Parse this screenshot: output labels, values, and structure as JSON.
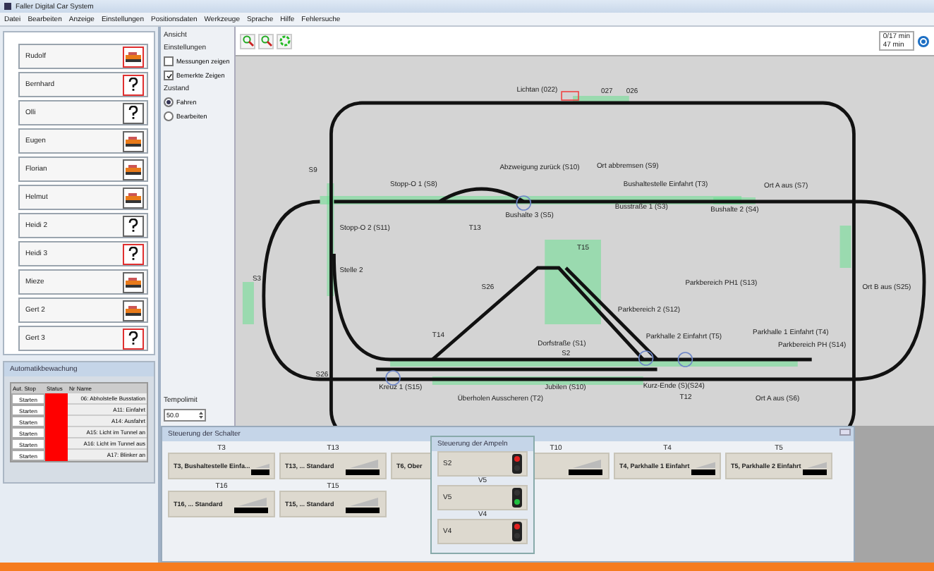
{
  "window": {
    "title": "Faller Digital Car System"
  },
  "menu": [
    "Datei",
    "Bearbeiten",
    "Anzeige",
    "Einstellungen",
    "Positionsdaten",
    "Werkzeuge",
    "Sprache",
    "Hilfe",
    "Fehlersuche"
  ],
  "vehicles": [
    {
      "name": "Rudolf",
      "kind": "car",
      "flagged": true
    },
    {
      "name": "Bernhard",
      "kind": "unknown",
      "flagged": true
    },
    {
      "name": "Olli",
      "kind": "unknown",
      "flagged": false
    },
    {
      "name": "Eugen",
      "kind": "car",
      "flagged": false
    },
    {
      "name": "Florian",
      "kind": "car",
      "flagged": false
    },
    {
      "name": "Helmut",
      "kind": "car",
      "flagged": false
    },
    {
      "name": "Heidi 2",
      "kind": "unknown",
      "flagged": false
    },
    {
      "name": "Heidi 3",
      "kind": "unknown",
      "flagged": true
    },
    {
      "name": "Mieze",
      "kind": "car",
      "flagged": false
    },
    {
      "name": "Gert 2",
      "kind": "car",
      "flagged": false
    },
    {
      "name": "Gert 3",
      "kind": "unknown",
      "flagged": true
    }
  ],
  "automation": {
    "title": "Automatikbewachung",
    "columns": [
      "Aut.",
      "Stop",
      "Status",
      "Nr",
      "Name"
    ],
    "rows": [
      {
        "button": "Starten",
        "color": "#ff0000",
        "name": "06: Abholstelle Busstation"
      },
      {
        "button": "Starten",
        "color": "#ff0000",
        "name": "A11: Einfahrt"
      },
      {
        "button": "Starten",
        "color": "#ff0000",
        "name": "A14: Ausfahrt"
      },
      {
        "button": "Starten",
        "color": "#ff0000",
        "name": "A15: Licht im Tunnel an"
      },
      {
        "button": "Starten",
        "color": "#ff0000",
        "name": "A16: Licht im Tunnel aus"
      },
      {
        "button": "Starten",
        "color": "#ff0000",
        "name": "A17: Blinker an"
      }
    ]
  },
  "settings": {
    "header": "Ansicht",
    "title": "Einstellungen",
    "checks": [
      {
        "label": "Messungen zeigen",
        "checked": false
      },
      {
        "label": "Bemerkte Zeigen",
        "checked": true
      }
    ],
    "mode_label": "Zustand",
    "modes": [
      {
        "label": "Fahren",
        "selected": true
      },
      {
        "label": "Bearbeiten",
        "selected": false
      }
    ],
    "speed_label": "Tempolimit",
    "speed_value": "50.0"
  },
  "toolbar": {
    "times": [
      "0/17 min",
      "47 min"
    ]
  },
  "track_labels": [
    "Lichtan (022)",
    "027",
    "026",
    "Abzweigung zurück (S10)",
    "Ort abbremsen (S9)",
    "S9",
    "Stopp-O 1 (S8)",
    "Bushaltestelle Einfahrt (T3)",
    "Ort A aus (S7)",
    "Bushalte 3 (S5)",
    "Busstraße 1 (S3)",
    "Bushalte 2 (S4)",
    "Stopp-O 2 (S11)",
    "T13",
    "T15",
    "Stelle 2",
    "S3",
    "S26",
    "Parkbereich PH1 (S13)",
    "Ort B aus (S25)",
    "Parkbereich 2 (S12)",
    "Parkhalle 2 Einfahrt (T5)",
    "Parkhalle 1 Einfahrt (T4)",
    "Parkbereich PH (S14)",
    "T14",
    "Dorfstraße (S1)",
    "S2",
    "S26",
    "Kreuz 1 (S15)",
    "Jubilen (S10)",
    "Kurz-Ende (S)(S24)",
    "Überholen Ausscheren (T2)",
    "T12",
    "Ort A aus (S6)"
  ],
  "switch_panel": {
    "title": "Steuerung der Schalter",
    "cards": [
      {
        "header": "T3",
        "label": "T3, Bushaltestelle Einfa..."
      },
      {
        "header": "T13",
        "label": "T13, ... Standard"
      },
      {
        "label": "T6, Ober"
      },
      {
        "header": "T10"
      },
      {
        "header": "T4",
        "label": "T4, Parkhalle 1 Einfahrt"
      },
      {
        "header": "T5",
        "label": "T5, Parkhalle 2 Einfahrt"
      },
      {
        "header": "T16",
        "label": "T16, ... Standard"
      },
      {
        "header": "T15",
        "label": "T15, ... Standard"
      }
    ]
  },
  "signal_panel": {
    "title": "Steuerung der Ampeln",
    "signals": [
      {
        "label": "S2",
        "kind": "stop"
      },
      {
        "header": "V5",
        "label": "V5",
        "kind": "go"
      },
      {
        "header": "V4",
        "label": "V4",
        "kind": "stop"
      }
    ]
  }
}
